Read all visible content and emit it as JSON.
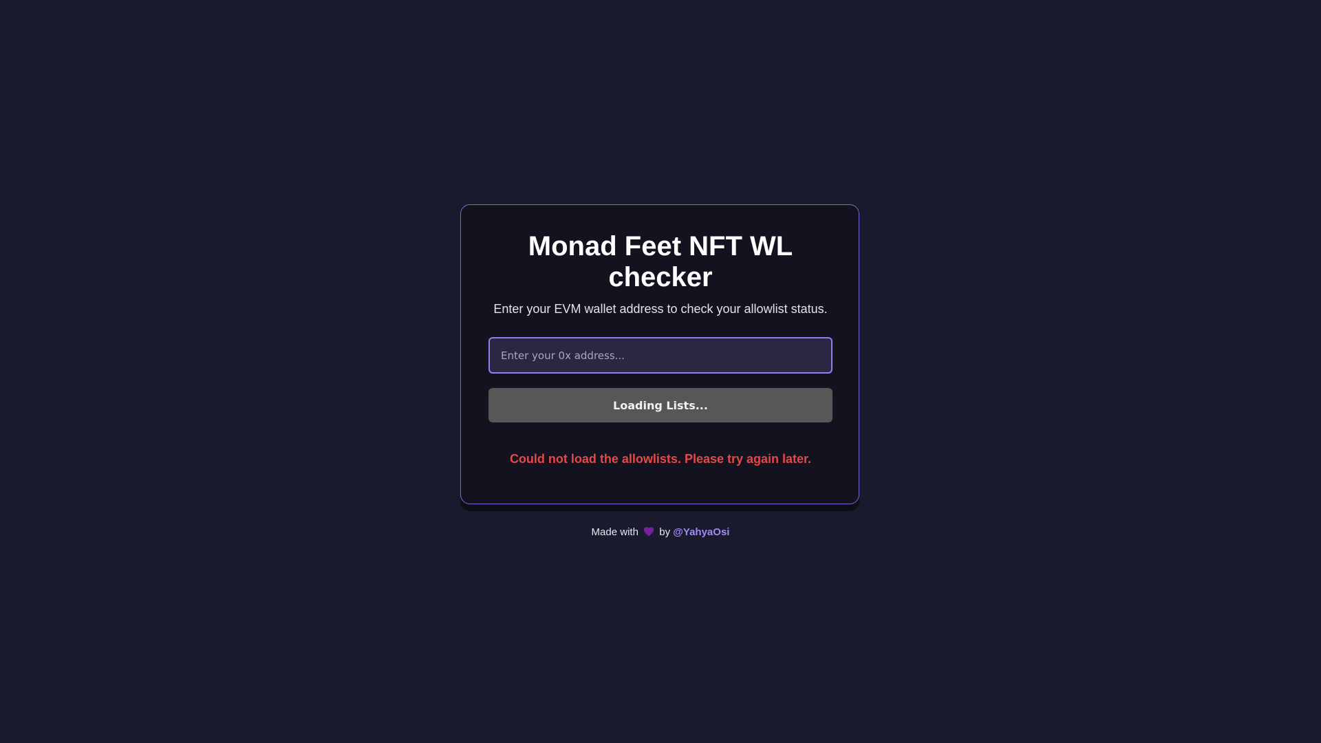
{
  "card": {
    "title": "Monad Feet NFT WL checker",
    "subtitle": "Enter your EVM wallet address to check your allowlist status.",
    "address_input": {
      "value": "",
      "placeholder": "Enter your 0x address..."
    },
    "check_button_label": "Loading Lists...",
    "error_message": "Could not load the allowlists. Please try again later."
  },
  "footer": {
    "prefix": "Made with",
    "heart_icon": "purple-heart-icon",
    "by": "by",
    "author": "@YahyaOsi"
  },
  "colors": {
    "background": "#1a1a2e",
    "card_background": "#13131f",
    "card_border": "#7b6ad8",
    "accent": "#9f8cf7",
    "error": "#e64848",
    "button_disabled": "#575757",
    "heart": "#7b1fa2"
  }
}
